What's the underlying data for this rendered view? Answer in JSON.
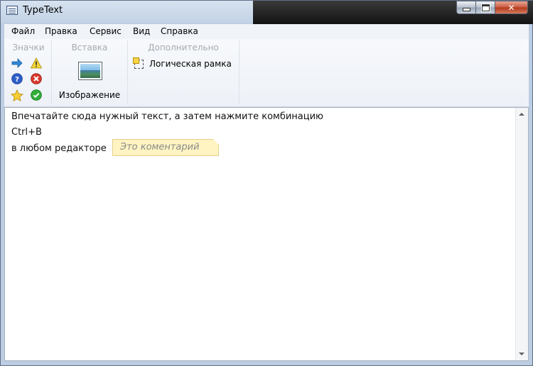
{
  "window": {
    "title": "TypeText"
  },
  "menu": [
    {
      "label": "Файл"
    },
    {
      "label": "Правка"
    },
    {
      "label": "Сервис"
    },
    {
      "label": "Вид"
    },
    {
      "label": "Справка"
    }
  ],
  "ribbon": {
    "groups": {
      "icons": "Значки",
      "insert": "Вставка",
      "extra": "Дополнительно"
    },
    "icons": [
      "arrow-right-icon",
      "warning-icon",
      "help-icon",
      "error-icon",
      "star-icon",
      "ok-icon"
    ],
    "image_label": "Изображение",
    "frame_label": "Логическая рамка"
  },
  "editor": {
    "line1": "Впечатайте сюда нужный текст, а затем нажмите комбинацию",
    "line2": "Ctrl+B",
    "line3": "в любом редакторе",
    "comment": "Это коментарий"
  }
}
